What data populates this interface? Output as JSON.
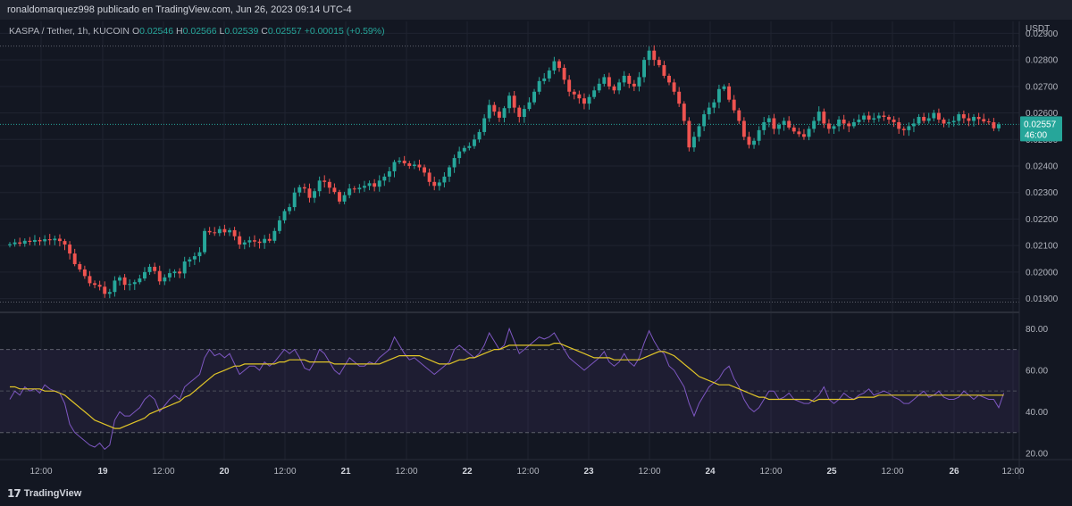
{
  "header": {
    "published_text": "ronaldomarquez998 publicado en TradingView.com, Jun 26, 2023 09:14 UTC-4"
  },
  "legend": {
    "symbol": "KASPA / Tether, 1h, KUCOIN",
    "o_label": "O",
    "o_value": "0.02546",
    "h_label": "H",
    "h_value": "0.02566",
    "l_label": "L",
    "l_value": "0.02539",
    "c_label": "C",
    "c_value": "0.02557",
    "change": "+0.00015 (+0.59%)"
  },
  "price_axis": {
    "currency": "USDT",
    "last_price": "0.02557",
    "countdown": "46:00"
  },
  "footer": {
    "brand": "TradingView",
    "logo_icon": "tradingview-logo-icon"
  },
  "colors": {
    "background": "#131722",
    "up": "#26a69a",
    "down": "#ef5350",
    "rsi_line": "#7e57c2",
    "rsi_ma": "#e2c628",
    "rsi_band": "rgba(126,87,194,0.10)",
    "text": "#b2b5be"
  },
  "chart_data": [
    {
      "type": "candlestick",
      "interval": "1h",
      "y_ticks": [
        "0.02900",
        "0.02800",
        "0.02700",
        "0.02600",
        "0.02500",
        "0.02400",
        "0.02300",
        "0.02200",
        "0.02100",
        "0.02000",
        "0.01900"
      ],
      "ylim": [
        0.01855,
        0.02945
      ],
      "x_ticks": [
        "12:00",
        "19",
        "12:00",
        "20",
        "12:00",
        "21",
        "12:00",
        "22",
        "12:00",
        "23",
        "12:00",
        "24",
        "12:00",
        "25",
        "12:00",
        "26",
        "12:00"
      ],
      "high_line": 0.02852,
      "low_line": 0.01887,
      "last_close": 0.02557,
      "close": [
        0.02105,
        0.02112,
        0.02107,
        0.02118,
        0.02114,
        0.02121,
        0.02116,
        0.02124,
        0.0212,
        0.02126,
        0.02117,
        0.02104,
        0.0207,
        0.0203,
        0.0201,
        0.01985,
        0.01958,
        0.01952,
        0.01945,
        0.01918,
        0.01925,
        0.01968,
        0.0198,
        0.01952,
        0.01955,
        0.01962,
        0.01976,
        0.02,
        0.0202,
        0.02004,
        0.01965,
        0.0198,
        0.01996,
        0.02002,
        0.01995,
        0.0204,
        0.02048,
        0.0206,
        0.02075,
        0.02155,
        0.0215,
        0.02147,
        0.02162,
        0.0215,
        0.02158,
        0.02135,
        0.02104,
        0.02112,
        0.0212,
        0.02115,
        0.0211,
        0.02125,
        0.02118,
        0.02155,
        0.02195,
        0.0223,
        0.02245,
        0.023,
        0.0232,
        0.02315,
        0.0228,
        0.02305,
        0.02345,
        0.0234,
        0.02318,
        0.02302,
        0.02266,
        0.0229,
        0.02315,
        0.02312,
        0.02318,
        0.02325,
        0.02335,
        0.02322,
        0.02345,
        0.0236,
        0.0238,
        0.02415,
        0.0242,
        0.0241,
        0.024,
        0.02405,
        0.02395,
        0.02375,
        0.0234,
        0.02325,
        0.02338,
        0.0236,
        0.02395,
        0.0243,
        0.02455,
        0.02468,
        0.02475,
        0.025,
        0.02528,
        0.0258,
        0.0263,
        0.02605,
        0.02582,
        0.02618,
        0.02665,
        0.0262,
        0.02585,
        0.02615,
        0.0264,
        0.0268,
        0.0272,
        0.0273,
        0.0276,
        0.02795,
        0.0277,
        0.02725,
        0.0268,
        0.0267,
        0.02655,
        0.02635,
        0.0266,
        0.02685,
        0.0271,
        0.02735,
        0.027,
        0.02685,
        0.02715,
        0.0274,
        0.0271,
        0.027,
        0.02735,
        0.028,
        0.02835,
        0.028,
        0.0278,
        0.0274,
        0.02715,
        0.0268,
        0.02635,
        0.0257,
        0.0247,
        0.0251,
        0.0255,
        0.02595,
        0.0262,
        0.0264,
        0.0269,
        0.027,
        0.0265,
        0.0261,
        0.0257,
        0.0251,
        0.0248,
        0.02495,
        0.02535,
        0.02565,
        0.0258,
        0.0254,
        0.02555,
        0.0257,
        0.02545,
        0.0253,
        0.0252,
        0.0251,
        0.0254,
        0.0257,
        0.02605,
        0.0256,
        0.0254,
        0.0255,
        0.02575,
        0.0256,
        0.0255,
        0.02565,
        0.02575,
        0.0259,
        0.02575,
        0.0258,
        0.0259,
        0.02585,
        0.02575,
        0.02565,
        0.0254,
        0.02535,
        0.0255,
        0.0256,
        0.02585,
        0.0257,
        0.0258,
        0.026,
        0.02575,
        0.0256,
        0.02565,
        0.0257,
        0.02595,
        0.0258,
        0.0257,
        0.02585,
        0.02577,
        0.02568,
        0.02565,
        0.02542,
        0.02557
      ],
      "highs_lows_note": ""
    },
    {
      "type": "line",
      "name": "RSI",
      "y_ticks": [
        "80.00",
        "60.00",
        "40.00",
        "20.00"
      ],
      "ylim": [
        17,
        87
      ],
      "bands": [
        70,
        50,
        30
      ],
      "series": [
        {
          "name": "rsi",
          "values": [
            46,
            50,
            48,
            52,
            50,
            51,
            49,
            53,
            51,
            50,
            49,
            44,
            34,
            30,
            28,
            26,
            24,
            23,
            25,
            22,
            24,
            36,
            40,
            38,
            38,
            40,
            42,
            46,
            48,
            46,
            40,
            43,
            46,
            48,
            46,
            52,
            54,
            56,
            58,
            66,
            70,
            67,
            68,
            66,
            68,
            63,
            58,
            60,
            62,
            62,
            60,
            64,
            62,
            64,
            67,
            70,
            68,
            70,
            66,
            61,
            60,
            64,
            70,
            68,
            64,
            60,
            58,
            62,
            66,
            64,
            62,
            62,
            64,
            63,
            66,
            68,
            70,
            76,
            72,
            68,
            65,
            66,
            64,
            62,
            60,
            58,
            60,
            62,
            64,
            70,
            72,
            70,
            68,
            66,
            68,
            72,
            78,
            74,
            70,
            72,
            80,
            74,
            68,
            70,
            72,
            74,
            76,
            75,
            76,
            78,
            74,
            70,
            66,
            64,
            62,
            60,
            62,
            64,
            66,
            69,
            64,
            62,
            64,
            68,
            64,
            62,
            66,
            73,
            79,
            74,
            70,
            68,
            62,
            60,
            56,
            52,
            44,
            38,
            44,
            48,
            52,
            54,
            56,
            60,
            62,
            56,
            52,
            46,
            42,
            40,
            42,
            46,
            50,
            50,
            46,
            47,
            49,
            46,
            45,
            44,
            44,
            46,
            48,
            52,
            46,
            44,
            46,
            49,
            47,
            46,
            48,
            49,
            51,
            48,
            49,
            50,
            49,
            47,
            46,
            44,
            44,
            46,
            48,
            50,
            47,
            48,
            50,
            47,
            46,
            46,
            47,
            50,
            48,
            46,
            48,
            47,
            46,
            46,
            42,
            49
          ]
        },
        {
          "name": "rsi-ma",
          "values": [
            52,
            52,
            51,
            51,
            51,
            51,
            51,
            50,
            50,
            50,
            49,
            48,
            46,
            44,
            42,
            40,
            38,
            36,
            35,
            34,
            33,
            32,
            32,
            33,
            34,
            35,
            36,
            37,
            39,
            40,
            41,
            42,
            43,
            44,
            45,
            47,
            48,
            50,
            52,
            54,
            56,
            58,
            59,
            60,
            61,
            62,
            62,
            63,
            63,
            63,
            63,
            63,
            63,
            63,
            64,
            64,
            65,
            65,
            65,
            65,
            64,
            64,
            64,
            64,
            64,
            63,
            63,
            63,
            63,
            63,
            63,
            63,
            63,
            63,
            63,
            64,
            65,
            66,
            67,
            67,
            67,
            67,
            67,
            66,
            65,
            64,
            63,
            63,
            63,
            64,
            65,
            65,
            66,
            66,
            67,
            68,
            69,
            70,
            70,
            71,
            72,
            72,
            72,
            72,
            72,
            72,
            72,
            72,
            72,
            73,
            73,
            72,
            71,
            70,
            69,
            68,
            67,
            66,
            66,
            66,
            66,
            65,
            65,
            65,
            65,
            65,
            65,
            66,
            67,
            68,
            69,
            69,
            68,
            67,
            65,
            63,
            61,
            59,
            57,
            56,
            55,
            54,
            53,
            53,
            53,
            52,
            51,
            50,
            49,
            48,
            47,
            47,
            46,
            46,
            46,
            46,
            46,
            46,
            46,
            46,
            46,
            45,
            46,
            46,
            46,
            46,
            46,
            46,
            46,
            46,
            47,
            47,
            47,
            47,
            48,
            48,
            48,
            48,
            48,
            48,
            48,
            48,
            48,
            48,
            48,
            48,
            48,
            48,
            48,
            48,
            48,
            48,
            48,
            48,
            48,
            48,
            48,
            48,
            48,
            48
          ]
        }
      ]
    }
  ]
}
